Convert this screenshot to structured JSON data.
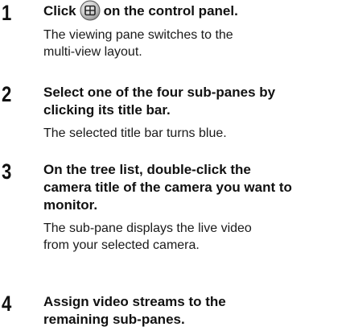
{
  "steps": [
    {
      "number": "1",
      "instruction_before_icon": "Click",
      "instruction_icon": "multi-view-grid-icon",
      "instruction_after_icon": "on the control panel.",
      "description_lines": [
        "The viewing pane switches to the",
        "multi-view layout."
      ]
    },
    {
      "number": "2",
      "instruction_lines": [
        "Select one of the four sub-panes by",
        "clicking its title bar."
      ],
      "description_lines": [
        "The selected title bar turns blue."
      ]
    },
    {
      "number": "3",
      "instruction_lines": [
        "On the tree list, double-click the",
        "camera title of the camera you want to",
        "monitor."
      ],
      "description_lines": [
        "The sub-pane displays the live video",
        "from your selected camera."
      ]
    },
    {
      "number": "4",
      "instruction_lines": [
        "Assign video streams to the",
        "remaining sub-panes."
      ]
    }
  ]
}
